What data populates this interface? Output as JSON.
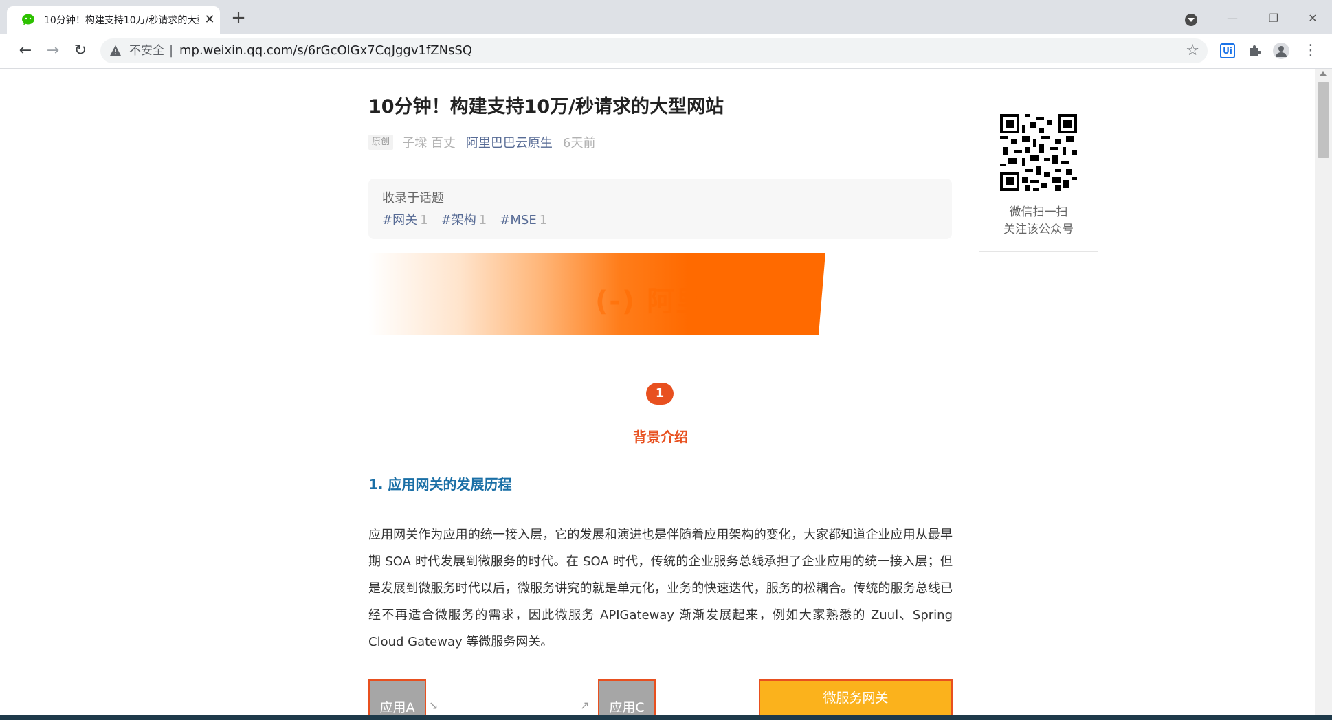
{
  "browser": {
    "tab": {
      "title": "10分钟！构建支持10万/秒请求的大型网站",
      "close": "✕"
    },
    "new_tab": "+",
    "omnibox": {
      "security_label": "不安全",
      "separator": "|",
      "url": "mp.weixin.qq.com/s/6rGcOlGx7CqJggv1fZNsSQ"
    },
    "extension_ui_label": "Ui",
    "window_controls": {
      "minimize": "—",
      "restore": "❐",
      "close": "✕"
    },
    "nav": {
      "back": "←",
      "forward": "→",
      "reload": "↻",
      "star": "☆",
      "menu": "⋮"
    }
  },
  "article": {
    "title": "10分钟！构建支持10万/秒请求的大型网站",
    "meta": {
      "original_badge": "原创",
      "author": "子墚 百丈",
      "account": "阿里巴巴云原生",
      "time": "6天前"
    },
    "topics": {
      "heading": "收录于话题",
      "tags": [
        {
          "name": "#网关",
          "count": "1"
        },
        {
          "name": "#架构",
          "count": "1"
        },
        {
          "name": "#MSE",
          "count": "1"
        }
      ]
    },
    "banner_text": "(-) 阿里",
    "section": {
      "number": "1",
      "title": "背景介绍"
    },
    "sub_heading": "1. 应用网关的发展历程",
    "paragraph": "应用网关作为应用的统一接入层，它的发展和演进也是伴随着应用架构的变化，大家都知道企业应用从最早期 SOA 时代发展到微服务的时代。在 SOA 时代，传统的企业服务总线承担了企业应用的统一接入层；但是发展到微服务时代以后，微服务讲究的就是单元化，业务的快速迭代，服务的松耦合。传统的服务总线已经不再适合微服务的需求，因此微服务 APIGateway 渐渐发展起来，例如大家熟悉的 Zuul、Spring Cloud Gateway 等微服务网关。",
    "diagram": {
      "box_a": "应用A",
      "box_c": "应用C",
      "gateway": "微服务网关"
    }
  },
  "sidebar": {
    "qr_caption_line1": "微信扫一扫",
    "qr_caption_line2": "关注该公众号"
  },
  "colors": {
    "accent_orange": "#e8501f",
    "link_blue": "#576b95",
    "heading_blue": "#1a6fa6",
    "gateway_yellow": "#fbb21c"
  }
}
